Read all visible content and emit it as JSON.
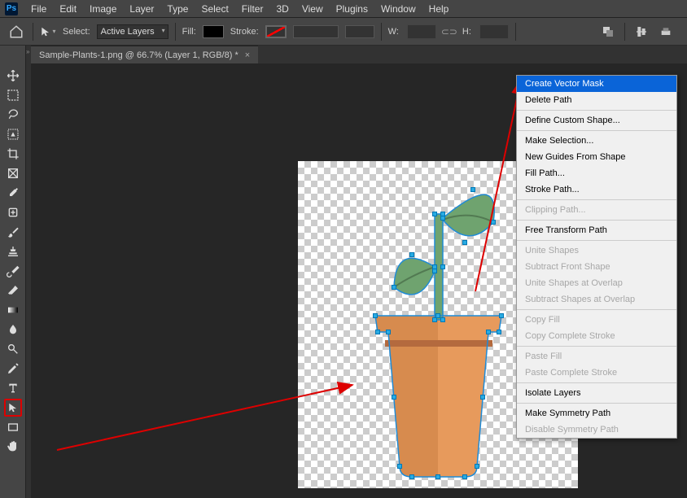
{
  "menubar": {
    "items": [
      "File",
      "Edit",
      "Image",
      "Layer",
      "Type",
      "Select",
      "Filter",
      "3D",
      "View",
      "Plugins",
      "Window",
      "Help"
    ]
  },
  "optbar": {
    "select_label": "Select:",
    "select_value": "Active Layers",
    "fill_label": "Fill:",
    "stroke_label": "Stroke:",
    "width_label": "W:",
    "height_label": "H:"
  },
  "tab": {
    "title": "Sample-Plants-1.png @ 66.7% (Layer 1, RGB/8) *"
  },
  "tools": [
    {
      "name": "move-tool"
    },
    {
      "name": "marquee-tool"
    },
    {
      "name": "lasso-tool"
    },
    {
      "name": "object-selection-tool"
    },
    {
      "name": "crop-tool"
    },
    {
      "name": "frame-tool"
    },
    {
      "name": "eyedropper-tool"
    },
    {
      "name": "healing-brush-tool"
    },
    {
      "name": "brush-tool"
    },
    {
      "name": "clone-stamp-tool"
    },
    {
      "name": "history-brush-tool"
    },
    {
      "name": "eraser-tool"
    },
    {
      "name": "gradient-tool"
    },
    {
      "name": "blur-tool"
    },
    {
      "name": "dodge-tool"
    },
    {
      "name": "pen-tool"
    },
    {
      "name": "type-tool"
    },
    {
      "name": "path-selection-tool",
      "selected": true
    },
    {
      "name": "rectangle-tool"
    },
    {
      "name": "hand-tool"
    }
  ],
  "context_menu": [
    {
      "label": "Create Vector Mask",
      "selected": true
    },
    {
      "label": "Delete Path"
    },
    {
      "sep": true
    },
    {
      "label": "Define Custom Shape..."
    },
    {
      "sep": true
    },
    {
      "label": "Make Selection..."
    },
    {
      "label": "New Guides From Shape"
    },
    {
      "label": "Fill Path..."
    },
    {
      "label": "Stroke Path..."
    },
    {
      "sep": true
    },
    {
      "label": "Clipping Path...",
      "disabled": true
    },
    {
      "sep": true
    },
    {
      "label": "Free Transform Path"
    },
    {
      "sep": true
    },
    {
      "label": "Unite Shapes",
      "disabled": true
    },
    {
      "label": "Subtract Front Shape",
      "disabled": true
    },
    {
      "label": "Unite Shapes at Overlap",
      "disabled": true
    },
    {
      "label": "Subtract Shapes at Overlap",
      "disabled": true
    },
    {
      "sep": true
    },
    {
      "label": "Copy Fill",
      "disabled": true
    },
    {
      "label": "Copy Complete Stroke",
      "disabled": true
    },
    {
      "sep": true
    },
    {
      "label": "Paste Fill",
      "disabled": true
    },
    {
      "label": "Paste Complete Stroke",
      "disabled": true
    },
    {
      "sep": true
    },
    {
      "label": "Isolate Layers"
    },
    {
      "sep": true
    },
    {
      "label": "Make Symmetry Path"
    },
    {
      "label": "Disable Symmetry Path",
      "disabled": true
    }
  ]
}
